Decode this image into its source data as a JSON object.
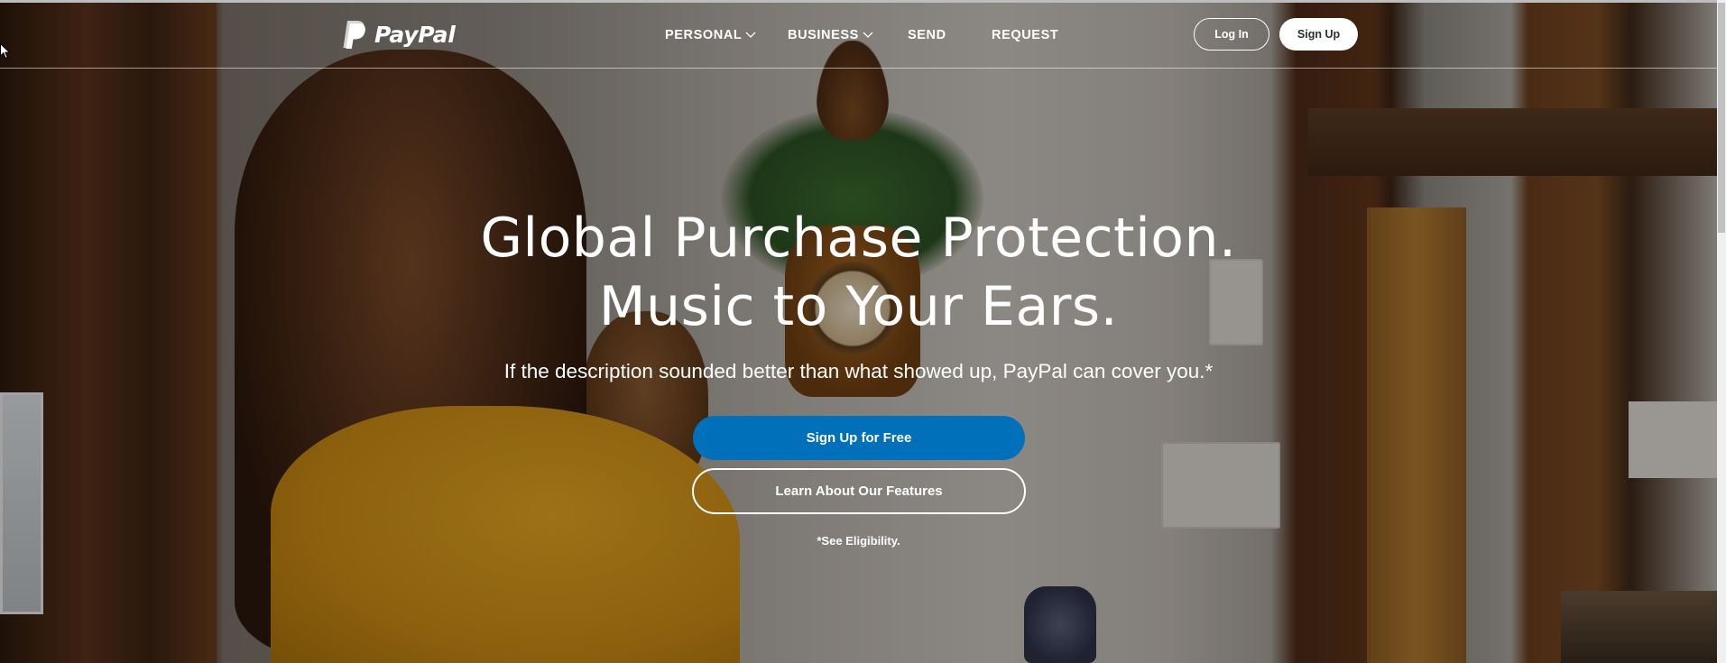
{
  "brand": {
    "name": "PayPal"
  },
  "nav": {
    "items": [
      {
        "label": "PERSONAL",
        "has_dropdown": true
      },
      {
        "label": "BUSINESS",
        "has_dropdown": true
      },
      {
        "label": "SEND",
        "has_dropdown": false
      },
      {
        "label": "REQUEST",
        "has_dropdown": false
      }
    ],
    "login_label": "Log In",
    "signup_label": "Sign Up"
  },
  "hero": {
    "title_line1": "Global Purchase Protection.",
    "title_line2": "Music to Your Ears.",
    "subtitle": "If the description sounded better than what showed up, PayPal can cover you.*",
    "primary_cta": "Sign Up for Free",
    "secondary_cta": "Learn About Our Features",
    "footnote": "*See Eligibility."
  },
  "colors": {
    "primary_button": "#0070ba",
    "text_on_hero": "#ffffff"
  },
  "icons": [
    "paypal-logo-icon",
    "chevron-down-icon",
    "mouse-cursor-icon"
  ]
}
